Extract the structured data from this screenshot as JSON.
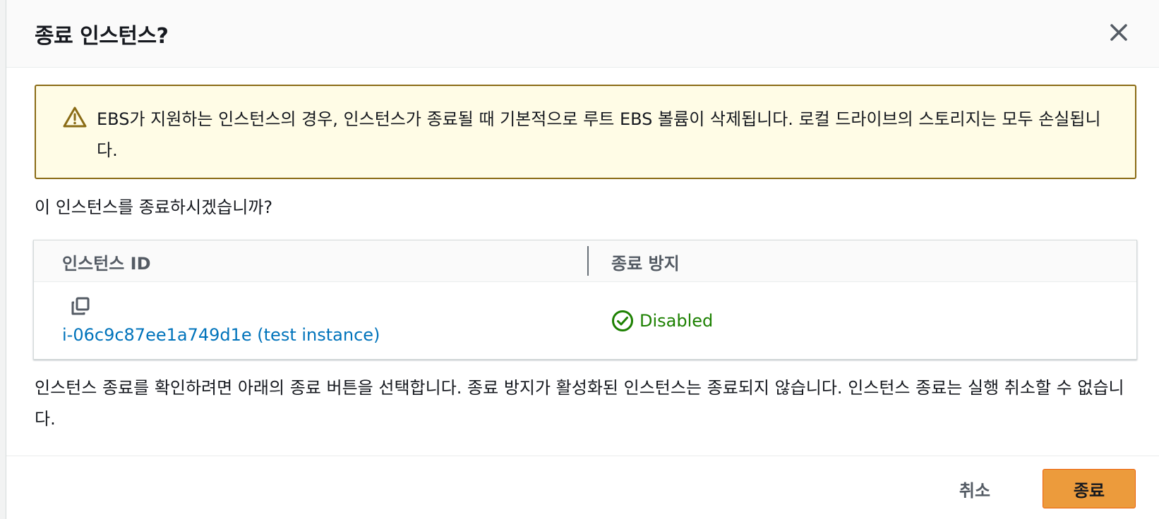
{
  "modal": {
    "title": "종료 인스턴스?"
  },
  "alert": {
    "icon": "warning-triangle-icon",
    "text": "EBS가 지원하는 인스턴스의 경우, 인스턴스가 종료될 때 기본적으로 루트 EBS 볼륨이 삭제됩니다. 로컬 드라이브의 스토리지는 모두 손실됩니다."
  },
  "question": "이 인스턴스를 종료하시겠습니까?",
  "table": {
    "columns": [
      "인스턴스 ID",
      "종료 방지"
    ],
    "rows": [
      {
        "instance_link": "i-06c9c87ee1a749d1e (test instance)",
        "protection_status": "Disabled"
      }
    ]
  },
  "info": "인스턴스 종료를 확인하려면 아래의 종료 버튼을 선택합니다. 종료 방지가 활성화된 인스턴스는 종료되지 않습니다. 인스턴스 종료는 실행 취소할 수 없습니다.",
  "footer": {
    "cancel_label": "취소",
    "terminate_label": "종료"
  },
  "colors": {
    "primary_button": "#ec9b3c",
    "warning_border": "#8a6b15",
    "warning_bg": "#fffce6",
    "link": "#0073bb",
    "success": "#1d8102"
  }
}
